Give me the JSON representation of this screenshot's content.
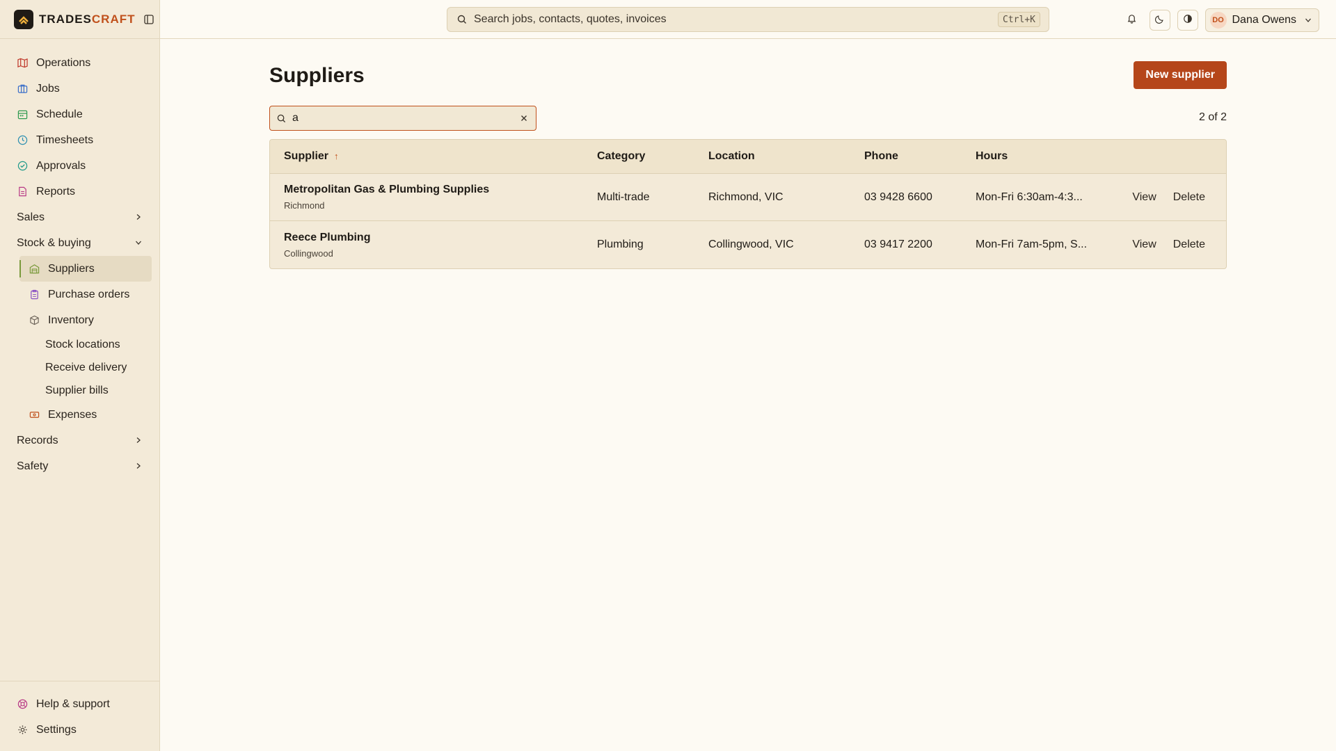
{
  "brand": {
    "name_a": "TRADES",
    "name_b": "CRAFT"
  },
  "nav": {
    "operations": "Operations",
    "jobs": "Jobs",
    "schedule": "Schedule",
    "timesheets": "Timesheets",
    "approvals": "Approvals",
    "reports": "Reports",
    "sales": "Sales",
    "stock_buying": "Stock & buying",
    "suppliers": "Suppliers",
    "purchase_orders": "Purchase orders",
    "inventory": "Inventory",
    "stock_locations": "Stock locations",
    "receive_delivery": "Receive delivery",
    "supplier_bills": "Supplier bills",
    "expenses": "Expenses",
    "records": "Records",
    "safety": "Safety",
    "help": "Help & support",
    "settings": "Settings"
  },
  "topbar": {
    "search_placeholder": "Search jobs, contacts, quotes, invoices",
    "shortcut": "Ctrl+K",
    "user_initials": "DO",
    "user_name": "Dana Owens"
  },
  "page": {
    "title": "Suppliers",
    "new_button": "New supplier",
    "filter_value": "a",
    "count": "2 of 2"
  },
  "table": {
    "headers": {
      "supplier": "Supplier",
      "category": "Category",
      "location": "Location",
      "phone": "Phone",
      "hours": "Hours"
    },
    "rows": [
      {
        "name": "Metropolitan Gas & Plumbing Supplies",
        "suburb": "Richmond",
        "category": "Multi-trade",
        "location": "Richmond, VIC",
        "phone": "03 9428 6600",
        "hours": "Mon-Fri 6:30am-4:3...",
        "view": "View",
        "delete": "Delete"
      },
      {
        "name": "Reece Plumbing",
        "suburb": "Collingwood",
        "category": "Plumbing",
        "location": "Collingwood, VIC",
        "phone": "03 9417 2200",
        "hours": "Mon-Fri 7am-5pm, S...",
        "view": "View",
        "delete": "Delete"
      }
    ]
  },
  "colors": {
    "accent": "#b5461a",
    "sidebar_bg": "#f3ead8",
    "page_bg": "#fdfaf3"
  }
}
